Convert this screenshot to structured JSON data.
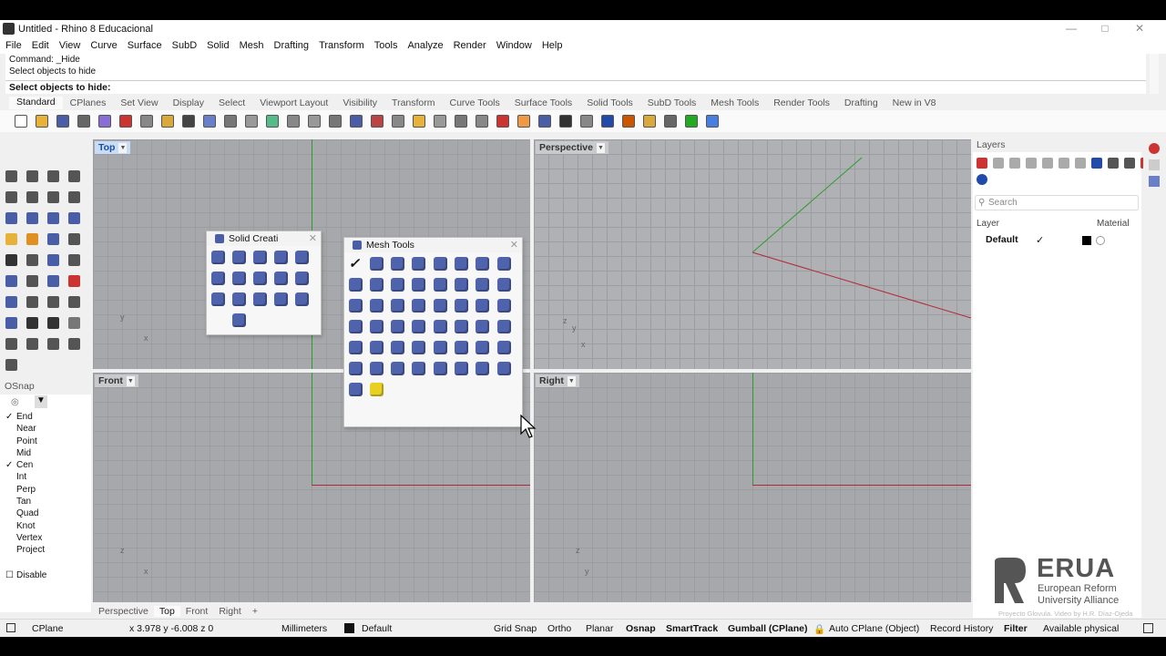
{
  "window": {
    "title": "Untitled - Rhino 8 Educacional"
  },
  "menu": [
    "File",
    "Edit",
    "View",
    "Curve",
    "Surface",
    "SubD",
    "Solid",
    "Mesh",
    "Drafting",
    "Transform",
    "Tools",
    "Analyze",
    "Render",
    "Window",
    "Help"
  ],
  "command": {
    "line1": "Command: _Hide",
    "line2": "Select objects to hide",
    "prompt": "Select objects to hide:"
  },
  "toolbar_tabs": [
    "Standard",
    "CPlanes",
    "Set View",
    "Display",
    "Select",
    "Viewport Layout",
    "Visibility",
    "Transform",
    "Curve Tools",
    "Surface Tools",
    "Solid Tools",
    "SubD Tools",
    "Mesh Tools",
    "Render Tools",
    "Drafting",
    "New in V8"
  ],
  "viewports": {
    "top": {
      "label": "Top",
      "axis_y": "y",
      "axis_x": "x"
    },
    "perspective": {
      "label": "Perspective",
      "axis_z": "z",
      "axis_y": "y",
      "axis_x": "x"
    },
    "front": {
      "label": "Front",
      "axis_z": "z",
      "axis_x": "x"
    },
    "right": {
      "label": "Right",
      "axis_z": "z",
      "axis_y": "y"
    }
  },
  "solid_creation": {
    "title": "Solid Creati"
  },
  "mesh_tools": {
    "title": "Mesh Tools"
  },
  "osnap": {
    "title": "OSnap",
    "items": [
      {
        "label": "End",
        "checked": "✓"
      },
      {
        "label": "Near",
        "checked": ""
      },
      {
        "label": "Point",
        "checked": ""
      },
      {
        "label": "Mid",
        "checked": ""
      },
      {
        "label": "Cen",
        "checked": "✓"
      },
      {
        "label": "Int",
        "checked": ""
      },
      {
        "label": "Perp",
        "checked": ""
      },
      {
        "label": "Tan",
        "checked": ""
      },
      {
        "label": "Quad",
        "checked": ""
      },
      {
        "label": "Knot",
        "checked": ""
      },
      {
        "label": "Vertex",
        "checked": ""
      },
      {
        "label": "Project",
        "checked": ""
      }
    ],
    "disable": "Disable"
  },
  "viewport_tabs": [
    "Perspective",
    "Top",
    "Front",
    "Right",
    "+"
  ],
  "layers": {
    "title": "Layers",
    "search_placeholder": "Search",
    "col_layer": "Layer",
    "col_material": "Material",
    "row_name": "Default",
    "row_current": "✓"
  },
  "status": {
    "cplane": "CPlane",
    "coords": "x 3.978 y -6.008 z 0",
    "units": "Millimeters",
    "layer": "Default",
    "grid_snap": "Grid Snap",
    "ortho": "Ortho",
    "planar": "Planar",
    "osnap": "Osnap",
    "smarttrack": "SmartTrack",
    "gumball": "Gumball (CPlane)",
    "autocplane": "Auto CPlane (Object)",
    "record_history": "Record History",
    "filter": "Filter",
    "available_physical": "Available physical"
  },
  "watermark": {
    "brand": "ERUA",
    "line1": "European Reform",
    "line2": "University Alliance",
    "credit": "Proyecto Glovula. Video by H.R. Díaz-Ojeda"
  },
  "colors": {
    "accent": "#1a4e9a",
    "mesh_icon": "#4e63ac",
    "x_axis": "#b3273a",
    "y_axis": "#2e9b2e"
  }
}
